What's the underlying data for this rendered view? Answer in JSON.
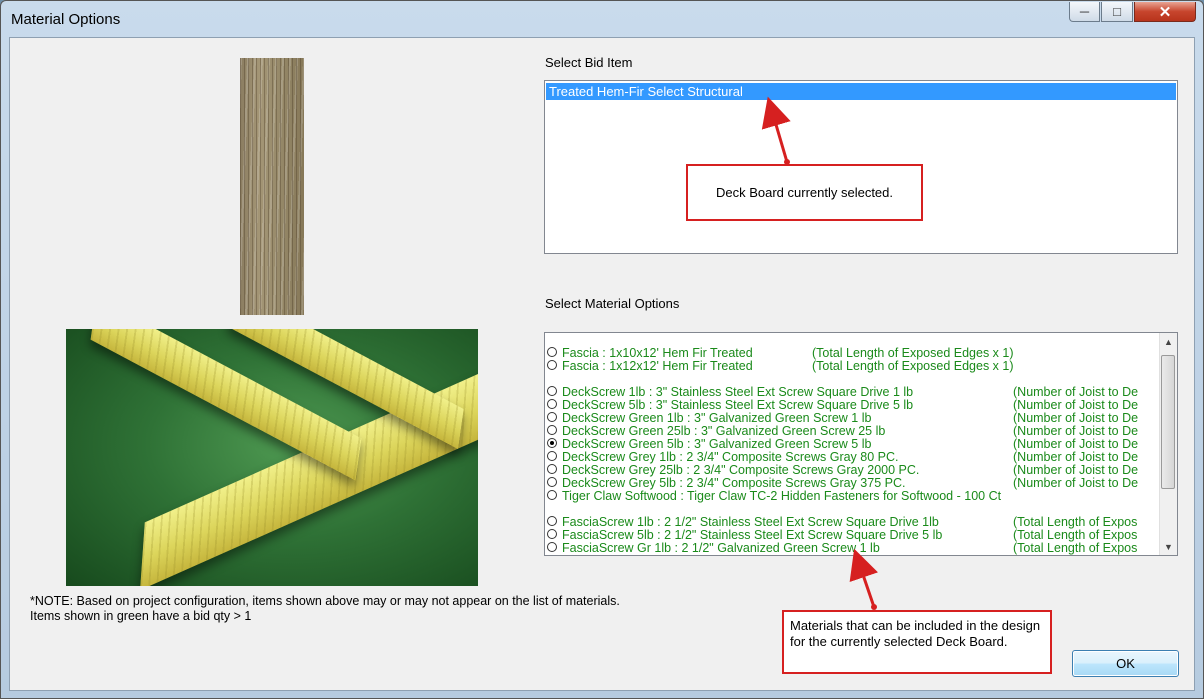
{
  "window": {
    "title": "Material Options"
  },
  "bid_item": {
    "label": "Select Bid Item",
    "selected": "Treated Hem-Fir Select Structural",
    "callout": "Deck Board currently selected."
  },
  "materials": {
    "label": "Select Material Options",
    "callout": "Materials that can be included in the design for the currently selected Deck Board.",
    "rows": [
      {
        "name": "Fascia : 1x10x12' Hem Fir Treated",
        "formula": "(Total Length of Exposed Edges x 1)",
        "checked": false,
        "col": "a"
      },
      {
        "name": "Fascia : 1x12x12' Hem Fir Treated",
        "formula": "(Total Length of Exposed Edges x 1)",
        "checked": false,
        "col": "a"
      },
      {
        "blank": true
      },
      {
        "name": "DeckScrew 1lb : 3\" Stainless Steel Ext Screw Square Drive 1 lb",
        "formula": "(Number of Joist to De",
        "checked": false,
        "col": "b"
      },
      {
        "name": "DeckScrew 5lb : 3\" Stainless Steel Ext Screw Square Drive 5 lb",
        "formula": "(Number of Joist to De",
        "checked": false,
        "col": "b"
      },
      {
        "name": "DeckScrew Green 1lb : 3\" Galvanized Green Screw 1 lb",
        "formula": "(Number of Joist to De",
        "checked": false,
        "col": "b"
      },
      {
        "name": "DeckScrew Green 25lb : 3\" Galvanized Green Screw 25 lb",
        "formula": "(Number of Joist to De",
        "checked": false,
        "col": "b"
      },
      {
        "name": "DeckScrew Green 5lb : 3\" Galvanized Green Screw 5 lb",
        "formula": "(Number of Joist to De",
        "checked": true,
        "col": "b"
      },
      {
        "name": "DeckScrew Grey 1lb : 2 3/4\" Composite Screws Gray 80 PC.",
        "formula": "(Number of Joist to De",
        "checked": false,
        "col": "b"
      },
      {
        "name": "DeckScrew Grey 25lb : 2 3/4\" Composite Screws Gray 2000 PC.",
        "formula": "(Number of Joist to De",
        "checked": false,
        "col": "b"
      },
      {
        "name": "DeckScrew Grey 5lb : 2 3/4\" Composite Screws Gray 375 PC.",
        "formula": "(Number of Joist to De",
        "checked": false,
        "col": "b"
      },
      {
        "name": "Tiger Claw Softwood : Tiger Claw TC-2 Hidden Fasteners for Softwood - 100 Ct",
        "formula": "",
        "checked": false,
        "col": "b"
      },
      {
        "blank": true
      },
      {
        "name": "FasciaScrew 1lb : 2 1/2\" Stainless Steel Ext Screw Square Drive 1lb",
        "formula": "(Total Length of Expos",
        "checked": false,
        "col": "b"
      },
      {
        "name": "FasciaScrew 5lb : 2 1/2\" Stainless Steel Ext Screw Square Drive 5 lb",
        "formula": "(Total Length of Expos",
        "checked": false,
        "col": "b"
      },
      {
        "name": "FasciaScrew Gr 1lb : 2 1/2\" Galvanized Green Screw 1 lb",
        "formula": "(Total Length of Expos",
        "checked": false,
        "col": "b"
      }
    ]
  },
  "note": {
    "line1": "*NOTE:  Based on project configuration, items shown above may or may not appear on the list of materials.",
    "line2": "Items shown in green have a bid qty > 1"
  },
  "ok_label": "OK",
  "colors": {
    "selection": "#3399ff",
    "green_text": "#1a8a1a",
    "callout_border": "#d62020"
  }
}
